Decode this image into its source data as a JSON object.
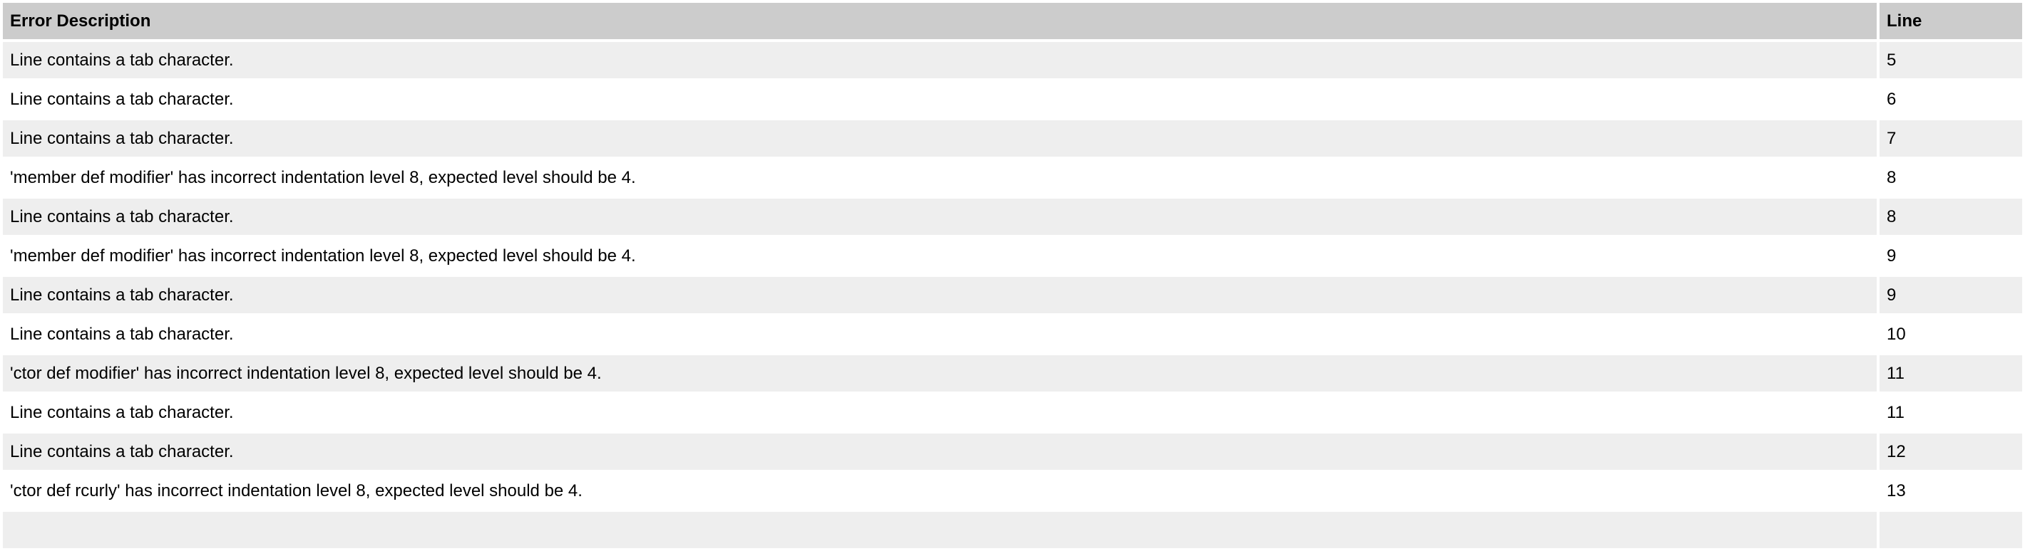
{
  "table": {
    "headers": {
      "description": "Error Description",
      "line": "Line"
    },
    "rows": [
      {
        "description": "Line contains a tab character.",
        "line": "5"
      },
      {
        "description": "Line contains a tab character.",
        "line": "6"
      },
      {
        "description": "Line contains a tab character.",
        "line": "7"
      },
      {
        "description": "'member def modifier' has incorrect indentation level 8, expected level should be 4.",
        "line": "8"
      },
      {
        "description": "Line contains a tab character.",
        "line": "8"
      },
      {
        "description": "'member def modifier' has incorrect indentation level 8, expected level should be 4.",
        "line": "9"
      },
      {
        "description": "Line contains a tab character.",
        "line": "9"
      },
      {
        "description": "Line contains a tab character.",
        "line": "10"
      },
      {
        "description": "'ctor def modifier' has incorrect indentation level 8, expected level should be 4.",
        "line": "11"
      },
      {
        "description": "Line contains a tab character.",
        "line": "11"
      },
      {
        "description": "Line contains a tab character.",
        "line": "12"
      },
      {
        "description": "'ctor def rcurly' has incorrect indentation level 8, expected level should be 4.",
        "line": "13"
      },
      {
        "description": "",
        "line": ""
      }
    ]
  },
  "colors": {
    "header_bg": "#cccccc",
    "row_alt_bg": "#eeeeee",
    "row_bg": "#ffffff"
  }
}
